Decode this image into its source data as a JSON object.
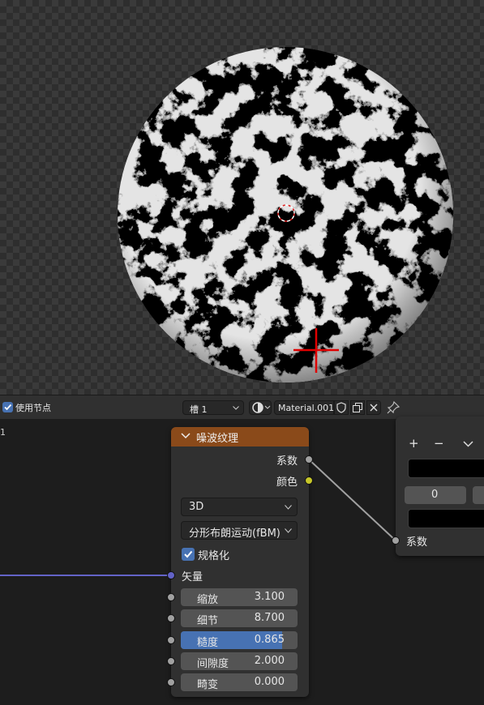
{
  "header": {
    "use_nodes_label": "使用节点",
    "use_nodes_checked": true,
    "slot_label": "槽 1",
    "material_name": "Material.001"
  },
  "editor": {
    "edge_label": "1"
  },
  "noise_node": {
    "title": "噪波纹理",
    "outputs": [
      "系数",
      "颜色"
    ],
    "dimensions": "3D",
    "noise_type": "分形布朗运动(fBM)",
    "normalize_label": "规格化",
    "normalize_checked": true,
    "vector_label": "矢量",
    "fields": [
      {
        "label": "缩放",
        "value": "3.100"
      },
      {
        "label": "细节",
        "value": "8.700"
      },
      {
        "label": "糙度",
        "value": "0.865",
        "fill": 0.865
      },
      {
        "label": "间隙度",
        "value": "2.000"
      },
      {
        "label": "畸变",
        "value": "0.000"
      }
    ]
  },
  "ramp_node": {
    "add_icon": "+",
    "remove_icon": "−",
    "position_value": "0",
    "input_label": "系数"
  },
  "colors": {
    "node_header": "#8a4a1a",
    "accent": "#4772b3",
    "link": "#a1a1a1",
    "vector_link": "#6363c7"
  }
}
